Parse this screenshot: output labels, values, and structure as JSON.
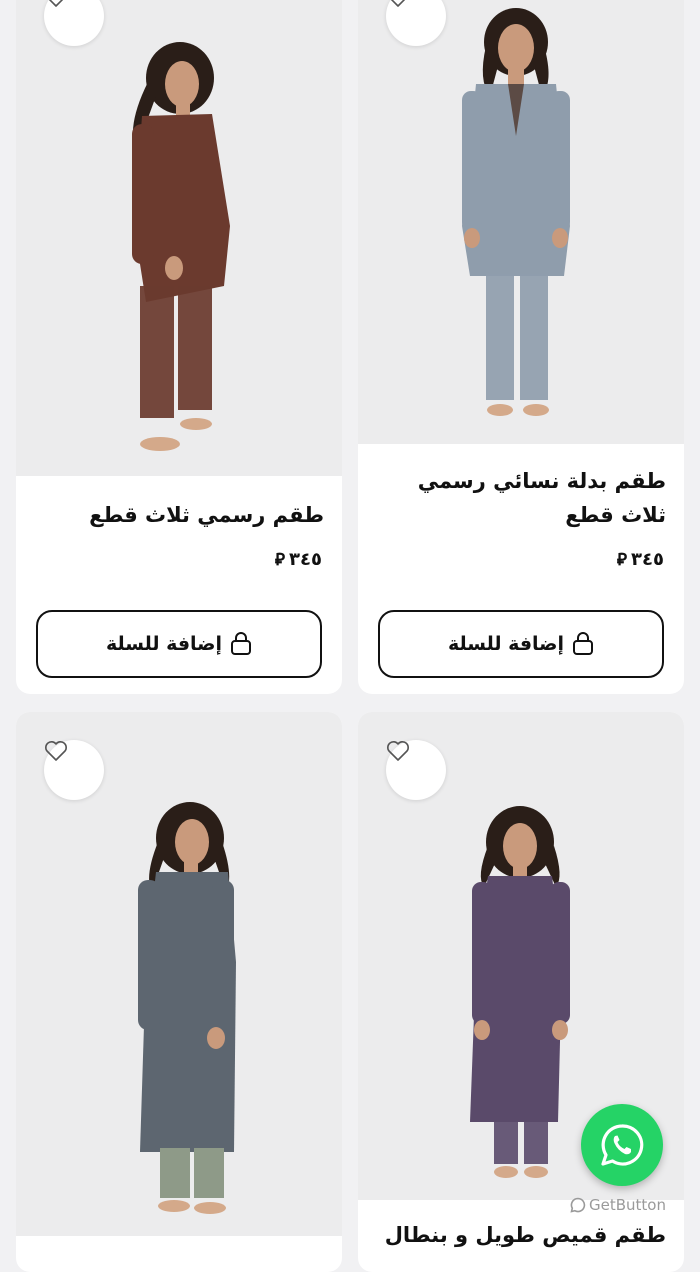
{
  "products": [
    {
      "title": "طقم بدلة نسائي رسمي ثلاث قطع",
      "price": "٣٤٥",
      "currency_symbol": "⃁",
      "cart_label": "إضافة للسلة",
      "outfit_color": "#8f9dac"
    },
    {
      "title": "طقم رسمي ثلاث قطع",
      "price": "٣٤٥",
      "currency_symbol": "⃁",
      "cart_label": "إضافة للسلة",
      "outfit_color": "#6b3a2e"
    },
    {
      "title": "طقم قميص طويل و بنطال",
      "outfit_color": "#5a4a6a"
    },
    {
      "outfit_color": "#5d6670"
    }
  ],
  "floating": {
    "whatsapp_icon": "whatsapp-icon",
    "getbutton_label": "GetButton"
  }
}
